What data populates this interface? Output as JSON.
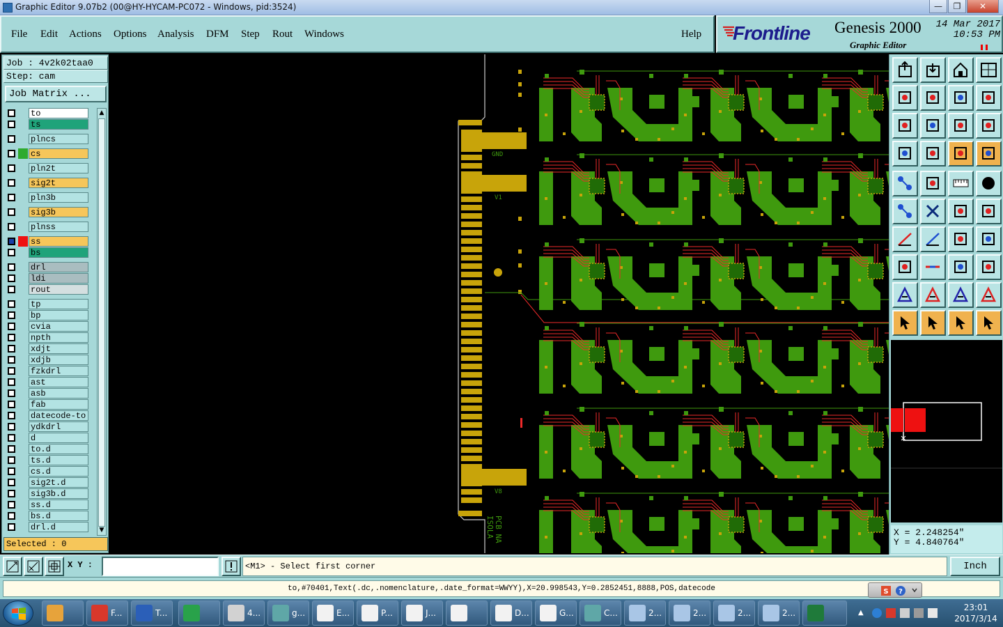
{
  "window": {
    "title": "Graphic Editor 9.07b2 (00@HY-HYCAM-PC072 - Windows, pid:3524)",
    "buttons": {
      "minimize": "—",
      "restore": "❐",
      "close": "✕"
    }
  },
  "menubar": {
    "items": [
      "File",
      "Edit",
      "Actions",
      "Options",
      "Analysis",
      "DFM",
      "Step",
      "Rout",
      "Windows"
    ],
    "help": "Help"
  },
  "brand": {
    "logo": "Frontline",
    "product": "Genesis 2000",
    "subtitle": "Graphic Editor",
    "date": "14 Mar 2017",
    "time": "10:53 PM"
  },
  "job": {
    "job_label": "Job : 4v2k02taa0",
    "step_label": "Step: cam",
    "matrix_button": "Job Matrix ..."
  },
  "layers": [
    {
      "name": "to",
      "bg": "#ffffff",
      "color": "",
      "marker": "✎"
    },
    {
      "name": "ts",
      "bg": "#1fa37a",
      "color": "",
      "marker": ""
    },
    {
      "name": "plncs",
      "bg": "#b3e3e3",
      "color": "",
      "marker": ""
    },
    {
      "name": "cs",
      "bg": "#f6c65a",
      "color": "#2eaa2e",
      "marker": ""
    },
    {
      "name": "pln2t",
      "bg": "#b3e3e3",
      "color": "",
      "marker": ""
    },
    {
      "name": "sig2t",
      "bg": "#f6c65a",
      "color": "",
      "marker": ""
    },
    {
      "name": "pln3b",
      "bg": "#b3e3e3",
      "color": "",
      "marker": ""
    },
    {
      "name": "sig3b",
      "bg": "#f6c65a",
      "color": "",
      "marker": ""
    },
    {
      "name": "plnss",
      "bg": "#b3e3e3",
      "color": "",
      "marker": ""
    },
    {
      "name": "ss",
      "bg": "#f6c65a",
      "color": "#ee1111",
      "marker": "▪"
    },
    {
      "name": "bs",
      "bg": "#1fa37a",
      "color": "",
      "marker": ""
    },
    {
      "name": "drl",
      "bg": "#a9bdc0",
      "color": "",
      "marker": ""
    },
    {
      "name": "ldi",
      "bg": "#a9bdc0",
      "color": "",
      "marker": ""
    },
    {
      "name": "rout",
      "bg": "#d4dfe0",
      "color": "",
      "marker": ""
    },
    {
      "name": "tp",
      "bg": "#b3e3e3",
      "color": "",
      "marker": ""
    },
    {
      "name": "bp",
      "bg": "#b3e3e3",
      "color": "",
      "marker": ""
    },
    {
      "name": "cvia",
      "bg": "#b3e3e3",
      "color": "",
      "marker": ""
    },
    {
      "name": "npth",
      "bg": "#b3e3e3",
      "color": "",
      "marker": ""
    },
    {
      "name": "xdjt",
      "bg": "#b3e3e3",
      "color": "",
      "marker": ""
    },
    {
      "name": "xdjb",
      "bg": "#b3e3e3",
      "color": "",
      "marker": ""
    },
    {
      "name": "fzkdrl",
      "bg": "#b3e3e3",
      "color": "",
      "marker": ""
    },
    {
      "name": "ast",
      "bg": "#b3e3e3",
      "color": "",
      "marker": "✎"
    },
    {
      "name": "asb",
      "bg": "#b3e3e3",
      "color": "",
      "marker": ""
    },
    {
      "name": "fab",
      "bg": "#b3e3e3",
      "color": "",
      "marker": ""
    },
    {
      "name": "datecode-to",
      "bg": "#b3e3e3",
      "color": "",
      "marker": ""
    },
    {
      "name": "ydkdrl",
      "bg": "#b3e3e3",
      "color": "",
      "marker": ""
    },
    {
      "name": "d",
      "bg": "#b3e3e3",
      "color": "",
      "marker": ""
    },
    {
      "name": "to.d",
      "bg": "#b3e3e3",
      "color": "",
      "marker": "✎"
    },
    {
      "name": "ts.d",
      "bg": "#b3e3e3",
      "color": "",
      "marker": ""
    },
    {
      "name": "cs.d",
      "bg": "#b3e3e3",
      "color": "",
      "marker": ""
    },
    {
      "name": "sig2t.d",
      "bg": "#b3e3e3",
      "color": "",
      "marker": ""
    },
    {
      "name": "sig3b.d",
      "bg": "#b3e3e3",
      "color": "",
      "marker": ""
    },
    {
      "name": "ss.d",
      "bg": "#b3e3e3",
      "color": "",
      "marker": ""
    },
    {
      "name": "bs.d",
      "bg": "#b3e3e3",
      "color": "",
      "marker": ""
    },
    {
      "name": "drl.d",
      "bg": "#b3e3e3",
      "color": "",
      "marker": ""
    }
  ],
  "selected_label": "Selected : 0",
  "canvas": {
    "labels": [
      "GND",
      "V1",
      "V8",
      "PCB NA",
      "ISOLA"
    ]
  },
  "coords": {
    "x": "X = 2.248254\"",
    "y": "Y = 4.840764\""
  },
  "bottom": {
    "xy_label": "X Y :",
    "xy_value": "",
    "message": "<M1> - Select first corner",
    "units": "Inch"
  },
  "status_line": "to,#70401,Text(.dc,.nomenclature,.date_format=WWYY),X=20.998543,Y=0.2852451,8888,POS,datecode",
  "taskbar": {
    "items": [
      {
        "label": "",
        "color": "#e7a33b"
      },
      {
        "label": "F...",
        "color": "#d8382b"
      },
      {
        "label": "T...",
        "color": "#2b5fb8"
      },
      {
        "label": "",
        "color": "#29a24a"
      },
      {
        "label": "4...",
        "color": "#d2d2d2"
      },
      {
        "label": "g...",
        "color": "#5fa7a7"
      },
      {
        "label": "E...",
        "color": "#f2f2f2"
      },
      {
        "label": "P...",
        "color": "#f2f2f2"
      },
      {
        "label": "J...",
        "color": "#f2f2f2"
      },
      {
        "label": "",
        "color": "#f2f2f2"
      },
      {
        "label": "D...",
        "color": "#f2f2f2"
      },
      {
        "label": "G...",
        "color": "#f2f2f2"
      },
      {
        "label": "C...",
        "color": "#5fa7a7"
      },
      {
        "label": "2...",
        "color": "#a9c6e6"
      },
      {
        "label": "2...",
        "color": "#a9c6e6"
      },
      {
        "label": "2...",
        "color": "#a9c6e6"
      },
      {
        "label": "2...",
        "color": "#a9c6e6"
      },
      {
        "label": "",
        "color": "#1f7a3a"
      }
    ],
    "time": "23:01",
    "date": "2017/3/14"
  }
}
